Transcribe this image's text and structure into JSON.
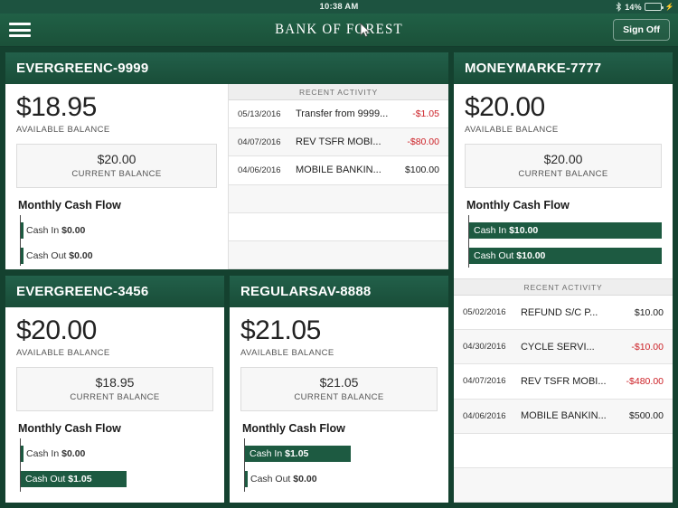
{
  "status_bar": {
    "time": "10:38 AM",
    "battery_percent": "14%",
    "bluetooth_icon": "bluetooth-icon",
    "battery_icon": "battery-icon",
    "charging_icon": "charging-bolt-icon"
  },
  "header": {
    "menu_icon": "hamburger-menu-icon",
    "brand": "BANK OF FOREST",
    "sign_off": "Sign Off"
  },
  "labels": {
    "available_balance": "AVAILABLE BALANCE",
    "current_balance": "CURRENT BALANCE",
    "cash_flow_title": "Monthly Cash Flow",
    "cash_in": "Cash In",
    "cash_out": "Cash Out",
    "recent_activity": "RECENT ACTIVITY"
  },
  "colors": {
    "brand_green": "#1d5a41",
    "page_background": "#14412f",
    "negative_amount": "#cc2026",
    "battery_fill": "#3ab54a"
  },
  "accounts": [
    {
      "name": "EVERGREENC-9999",
      "available_balance": "$18.95",
      "current_balance": "$20.00",
      "cash_in": "$0.00",
      "cash_out": "$0.00",
      "cash_in_pct": 0,
      "cash_out_pct": 0,
      "activity": [
        {
          "date": "05/13/2016",
          "description": "Transfer from 9999...",
          "amount": "-$1.05",
          "negative": true
        },
        {
          "date": "04/07/2016",
          "description": "REV TSFR MOBI...",
          "amount": "-$80.00",
          "negative": true
        },
        {
          "date": "04/06/2016",
          "description": "MOBILE BANKIN...",
          "amount": "$100.00",
          "negative": false
        },
        {
          "date": "",
          "description": "",
          "amount": "",
          "negative": false
        },
        {
          "date": "",
          "description": "",
          "amount": "",
          "negative": false
        },
        {
          "date": "",
          "description": "",
          "amount": "",
          "negative": false
        }
      ]
    },
    {
      "name": "MONEYMARKE-7777",
      "available_balance": "$20.00",
      "current_balance": "$20.00",
      "cash_in": "$10.00",
      "cash_out": "$10.00",
      "cash_in_pct": 100,
      "cash_out_pct": 100,
      "activity": [
        {
          "date": "05/02/2016",
          "description": "REFUND S/C P...",
          "amount": "$10.00",
          "negative": false
        },
        {
          "date": "04/30/2016",
          "description": "CYCLE SERVI...",
          "amount": "-$10.00",
          "negative": true
        },
        {
          "date": "04/07/2016",
          "description": "REV TSFR MOBI...",
          "amount": "-$480.00",
          "negative": true
        },
        {
          "date": "04/06/2016",
          "description": "MOBILE BANKIN...",
          "amount": "$500.00",
          "negative": false
        },
        {
          "date": "",
          "description": "",
          "amount": "",
          "negative": false
        },
        {
          "date": "",
          "description": "",
          "amount": "",
          "negative": false
        }
      ]
    },
    {
      "name": "EVERGREENC-3456",
      "available_balance": "$20.00",
      "current_balance": "$18.95",
      "cash_in": "$0.00",
      "cash_out": "$1.05",
      "cash_in_pct": 0,
      "cash_out_pct": 55,
      "activity": []
    },
    {
      "name": "REGULARSAV-8888",
      "available_balance": "$21.05",
      "current_balance": "$21.05",
      "cash_in": "$1.05",
      "cash_out": "$0.00",
      "cash_in_pct": 55,
      "cash_out_pct": 0,
      "activity": []
    }
  ]
}
